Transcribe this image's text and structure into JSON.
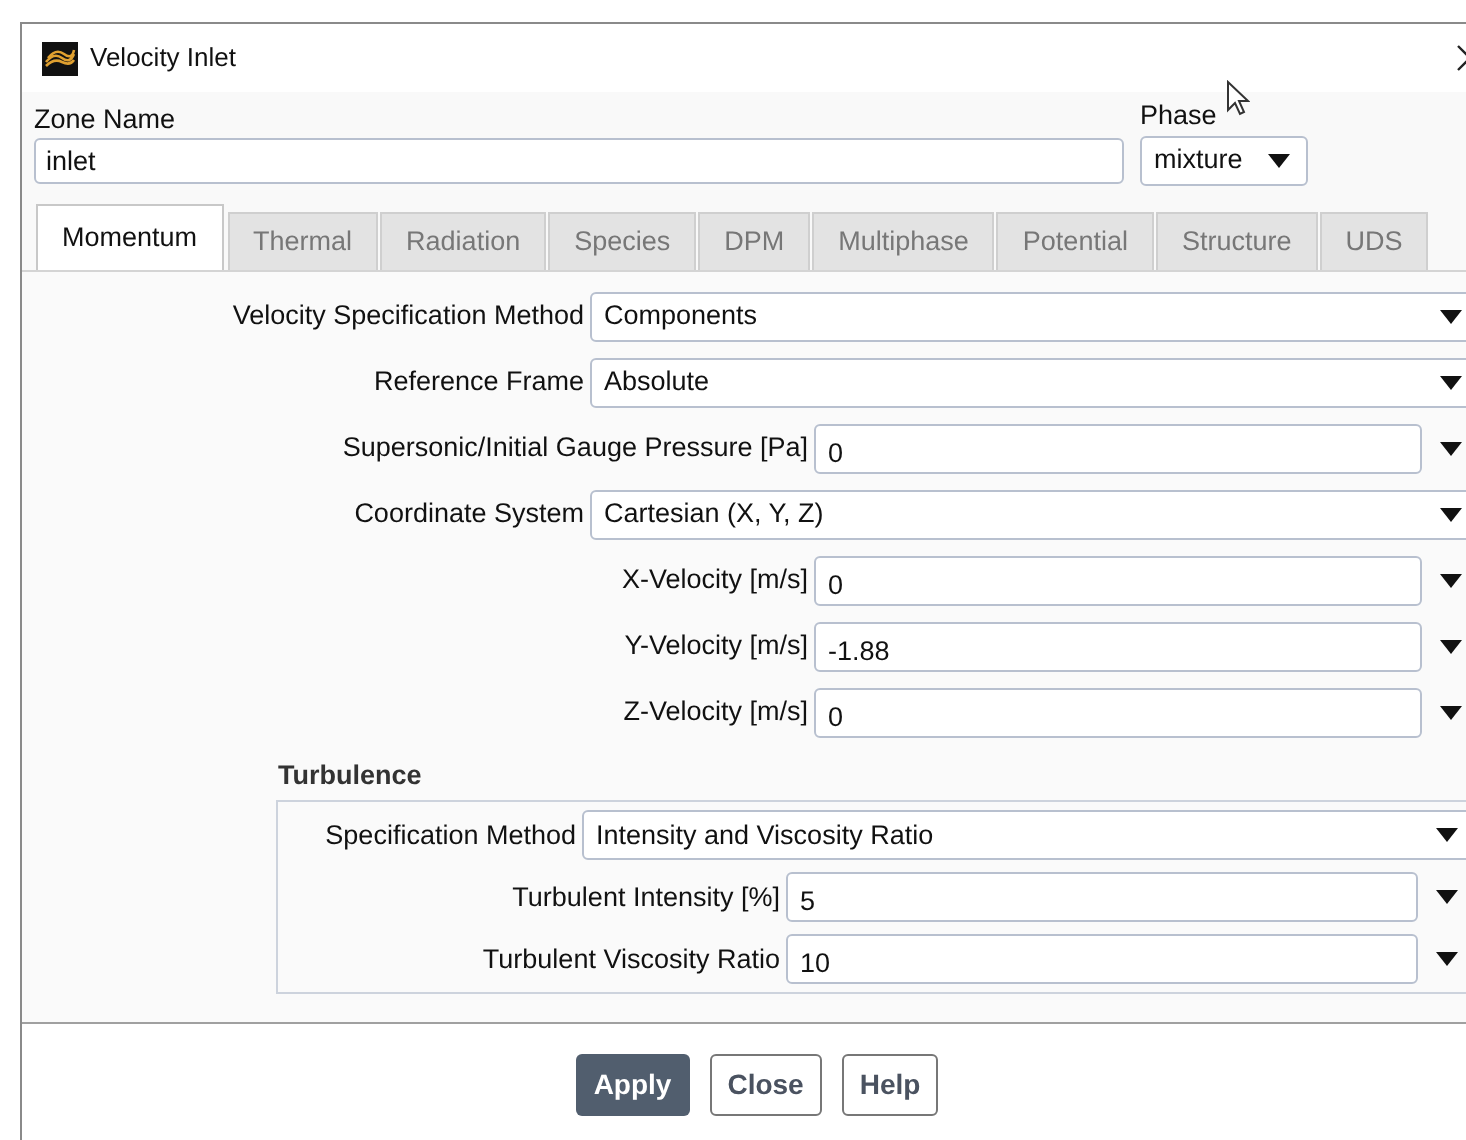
{
  "window": {
    "title": "Velocity Inlet"
  },
  "zone_name": {
    "label": "Zone Name",
    "value": "inlet"
  },
  "phase": {
    "label": "Phase",
    "value": "mixture"
  },
  "tabs": [
    {
      "label": "Momentum",
      "selected": true
    },
    {
      "label": "Thermal",
      "selected": false
    },
    {
      "label": "Radiation",
      "selected": false
    },
    {
      "label": "Species",
      "selected": false
    },
    {
      "label": "DPM",
      "selected": false
    },
    {
      "label": "Multiphase",
      "selected": false
    },
    {
      "label": "Potential",
      "selected": false
    },
    {
      "label": "Structure",
      "selected": false
    },
    {
      "label": "UDS",
      "selected": false
    }
  ],
  "fields": [
    {
      "kind": "dropdown",
      "label": "Velocity Specification Method",
      "value": "Components"
    },
    {
      "kind": "dropdown",
      "label": "Reference Frame",
      "value": "Absolute"
    },
    {
      "kind": "number",
      "label": "Supersonic/Initial Gauge Pressure [Pa]",
      "value": "0"
    },
    {
      "kind": "dropdown",
      "label": "Coordinate System",
      "value": "Cartesian (X, Y, Z)"
    },
    {
      "kind": "number",
      "label": "X-Velocity [m/s]",
      "value": "0"
    },
    {
      "kind": "number",
      "label": "Y-Velocity [m/s]",
      "value": "-1.88"
    },
    {
      "kind": "number",
      "label": "Z-Velocity [m/s]",
      "value": "0"
    }
  ],
  "turbulence": {
    "title": "Turbulence",
    "fields": [
      {
        "kind": "dropdown",
        "label": "Specification Method",
        "value": "Intensity and Viscosity Ratio"
      },
      {
        "kind": "number",
        "label": "Turbulent Intensity [%]",
        "value": "5"
      },
      {
        "kind": "number",
        "label": "Turbulent Viscosity Ratio",
        "value": "10"
      }
    ]
  },
  "buttons": [
    {
      "label": "Apply",
      "primary": true
    },
    {
      "label": "Close",
      "primary": false
    },
    {
      "label": "Help",
      "primary": false
    }
  ]
}
